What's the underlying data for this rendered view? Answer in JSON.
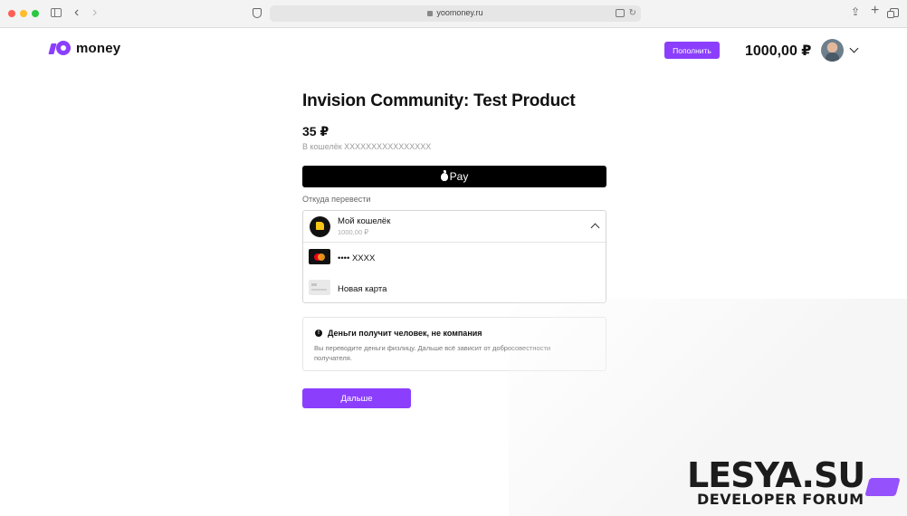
{
  "browser": {
    "url": "yoomoney.ru"
  },
  "header": {
    "logo_text": "money",
    "topup_label": "Пополнить",
    "balance": "1000,00 ₽"
  },
  "payment": {
    "title": "Invision Community: Test Product",
    "amount": "35 ₽",
    "wallet_number": "В кошелёк XXXXXXXXXXXXXXXX",
    "applepay_label": "Pay",
    "source_label": "Откуда перевести",
    "source": {
      "selected": {
        "title": "Мой кошелёк",
        "subtitle": "1000,00 ₽"
      },
      "options": [
        {
          "label": "•••• XXXX",
          "icon": "mastercard-icon"
        },
        {
          "label": "Новая карта",
          "icon": "card-icon"
        }
      ]
    },
    "warning": {
      "title": "Деньги получит человек, не компания",
      "text": "Вы переводите деньги физлицу. Дальше всё зависит от добросовестности получателя."
    },
    "next_label": "Дальше"
  },
  "watermark": {
    "main": "LESYA.SU",
    "sub": "DEVELOPER FORUM"
  },
  "colors": {
    "accent": "#8b3ffd",
    "applepay": "#000000",
    "wallet_icon": "#f5c518"
  }
}
